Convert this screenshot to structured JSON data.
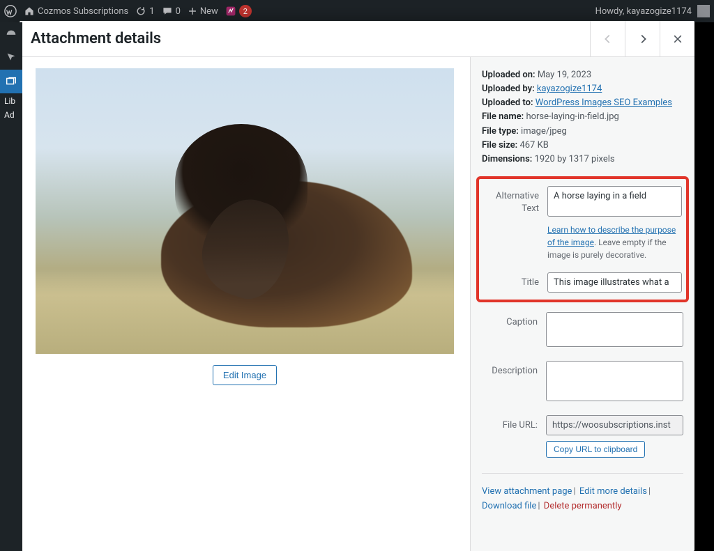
{
  "adminbar": {
    "site_name": "Cozmos Subscriptions",
    "update_count": "1",
    "comments_count": "0",
    "new_label": "New",
    "seo_count": "2",
    "howdy": "Howdy, kayazogize1174"
  },
  "sidebar_hint": {
    "lib": "Lib",
    "add": "Ad"
  },
  "modal": {
    "title": "Attachment details",
    "edit_image": "Edit Image"
  },
  "meta": {
    "uploaded_on_label": "Uploaded on:",
    "uploaded_on": "May 19, 2023",
    "uploaded_by_label": "Uploaded by:",
    "uploaded_by": "kayazogize1174",
    "uploaded_to_label": "Uploaded to:",
    "uploaded_to": "WordPress Images SEO Examples",
    "file_name_label": "File name:",
    "file_name": "horse-laying-in-field.jpg",
    "file_type_label": "File type:",
    "file_type": "image/jpeg",
    "file_size_label": "File size:",
    "file_size": "467 KB",
    "dimensions_label": "Dimensions:",
    "dimensions": "1920 by 1317 pixels"
  },
  "fields": {
    "alt_label": "Alternative Text",
    "alt_value": "A horse laying in a field",
    "alt_help_link": "Learn how to describe the purpose of the image",
    "alt_help_rest": ". Leave empty if the image is purely decorative.",
    "title_label": "Title",
    "title_value": "This image illustrates what a",
    "caption_label": "Caption",
    "caption_value": "",
    "description_label": "Description",
    "description_value": "",
    "file_url_label": "File URL:",
    "file_url_value": "https://woosubscriptions.inst",
    "copy_url": "Copy URL to clipboard"
  },
  "links": {
    "view": "View attachment page",
    "edit": "Edit more details",
    "download": "Download file",
    "delete": "Delete permanently"
  }
}
